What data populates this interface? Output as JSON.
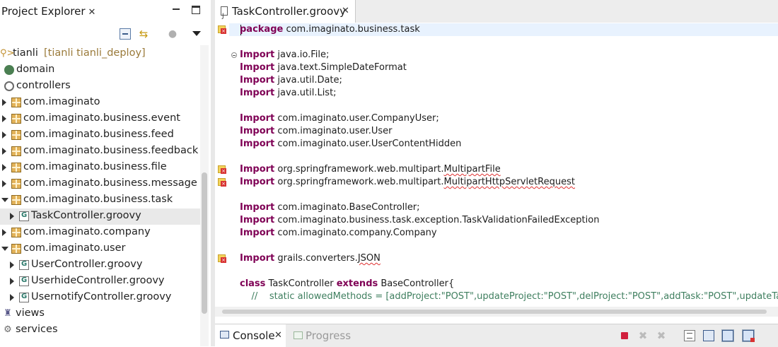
{
  "project_explorer": {
    "title": "Project Explorer",
    "close_glyph": "✕",
    "toolbar_icons": [
      "collapse-all-icon",
      "link-with-editor-icon",
      "focus-icon",
      "view-menu-icon"
    ],
    "project": {
      "name": "tianli",
      "decoration": "[tianli tianli_deploy]"
    },
    "items": [
      {
        "label": "domain",
        "icon": "domain-icon"
      },
      {
        "label": "controllers",
        "icon": "controllers-icon"
      },
      {
        "label": "com.imaginato",
        "icon": "package-icon"
      },
      {
        "label": "com.imaginato.business.event",
        "icon": "package-icon"
      },
      {
        "label": "com.imaginato.business.feed",
        "icon": "package-icon"
      },
      {
        "label": "com.imaginato.business.feedback",
        "icon": "package-icon"
      },
      {
        "label": "com.imaginato.business.file",
        "icon": "package-icon"
      },
      {
        "label": "com.imaginato.business.message",
        "icon": "package-icon"
      },
      {
        "label": "com.imaginato.business.task",
        "icon": "package-icon"
      },
      {
        "label": "TaskController.groovy",
        "icon": "groovy-file-icon",
        "selected": true
      },
      {
        "label": "com.imaginato.company",
        "icon": "package-icon"
      },
      {
        "label": "com.imaginato.user",
        "icon": "package-icon"
      },
      {
        "label": "UserController.groovy",
        "icon": "groovy-file-icon"
      },
      {
        "label": "UserhideController.groovy",
        "icon": "groovy-file-icon"
      },
      {
        "label": "UsernotifyController.groovy",
        "icon": "groovy-file-icon"
      },
      {
        "label": "views",
        "icon": "views-icon"
      },
      {
        "label": "services",
        "icon": "services-icon"
      }
    ]
  },
  "editor": {
    "tab_title": "TaskController.groovy",
    "close_glyph": "✕",
    "code": {
      "package_kw": "package",
      "package_name": " com.imaginato.business.task",
      "import_kw": "Import",
      "imports": [
        "java.io.File;",
        "java.text.SimpleDateFormat",
        "java.util.Date;",
        "java.util.List;",
        "com.imaginato.user.CompanyUser;",
        "com.imaginato.user.User",
        "com.imaginato.user.UserContentHidden",
        "org.springframework.web.multipart.",
        "org.springframework.web.multipart.",
        "com.imaginato.BaseController;",
        "com.imaginato.business.task.exception.TaskValidationFailedException",
        "com.imaginato.company.Company",
        "grails.converters."
      ],
      "error_tokens": [
        "MultipartFile",
        "MultipartHttpServletRequest",
        "JSON"
      ],
      "class_kw": "class",
      "class_name": " TaskController ",
      "extends_kw": "extends",
      "base": " BaseController{",
      "comment": "    //    static allowedMethods = [addProject:\"POST\",updateProject:\"POST\",delProject:\"POST\",addTask:\"POST\",updateTask:\"POST\""
    }
  },
  "console": {
    "console_label": "Console",
    "progress_label": "Progress",
    "close_glyph": "✕",
    "toolbar_icons": [
      "terminate-icon",
      "remove-launch-icon",
      "remove-all-icon",
      "clear-console-icon",
      "scroll-lock-icon",
      "pin-console-icon",
      "display-selected-console-icon"
    ]
  },
  "colors": {
    "keyword": "#7f0055",
    "comment": "#3f7f5f",
    "current_line": "#e8f2fe",
    "selection": "#e9e9e9",
    "error": "#d83333"
  }
}
